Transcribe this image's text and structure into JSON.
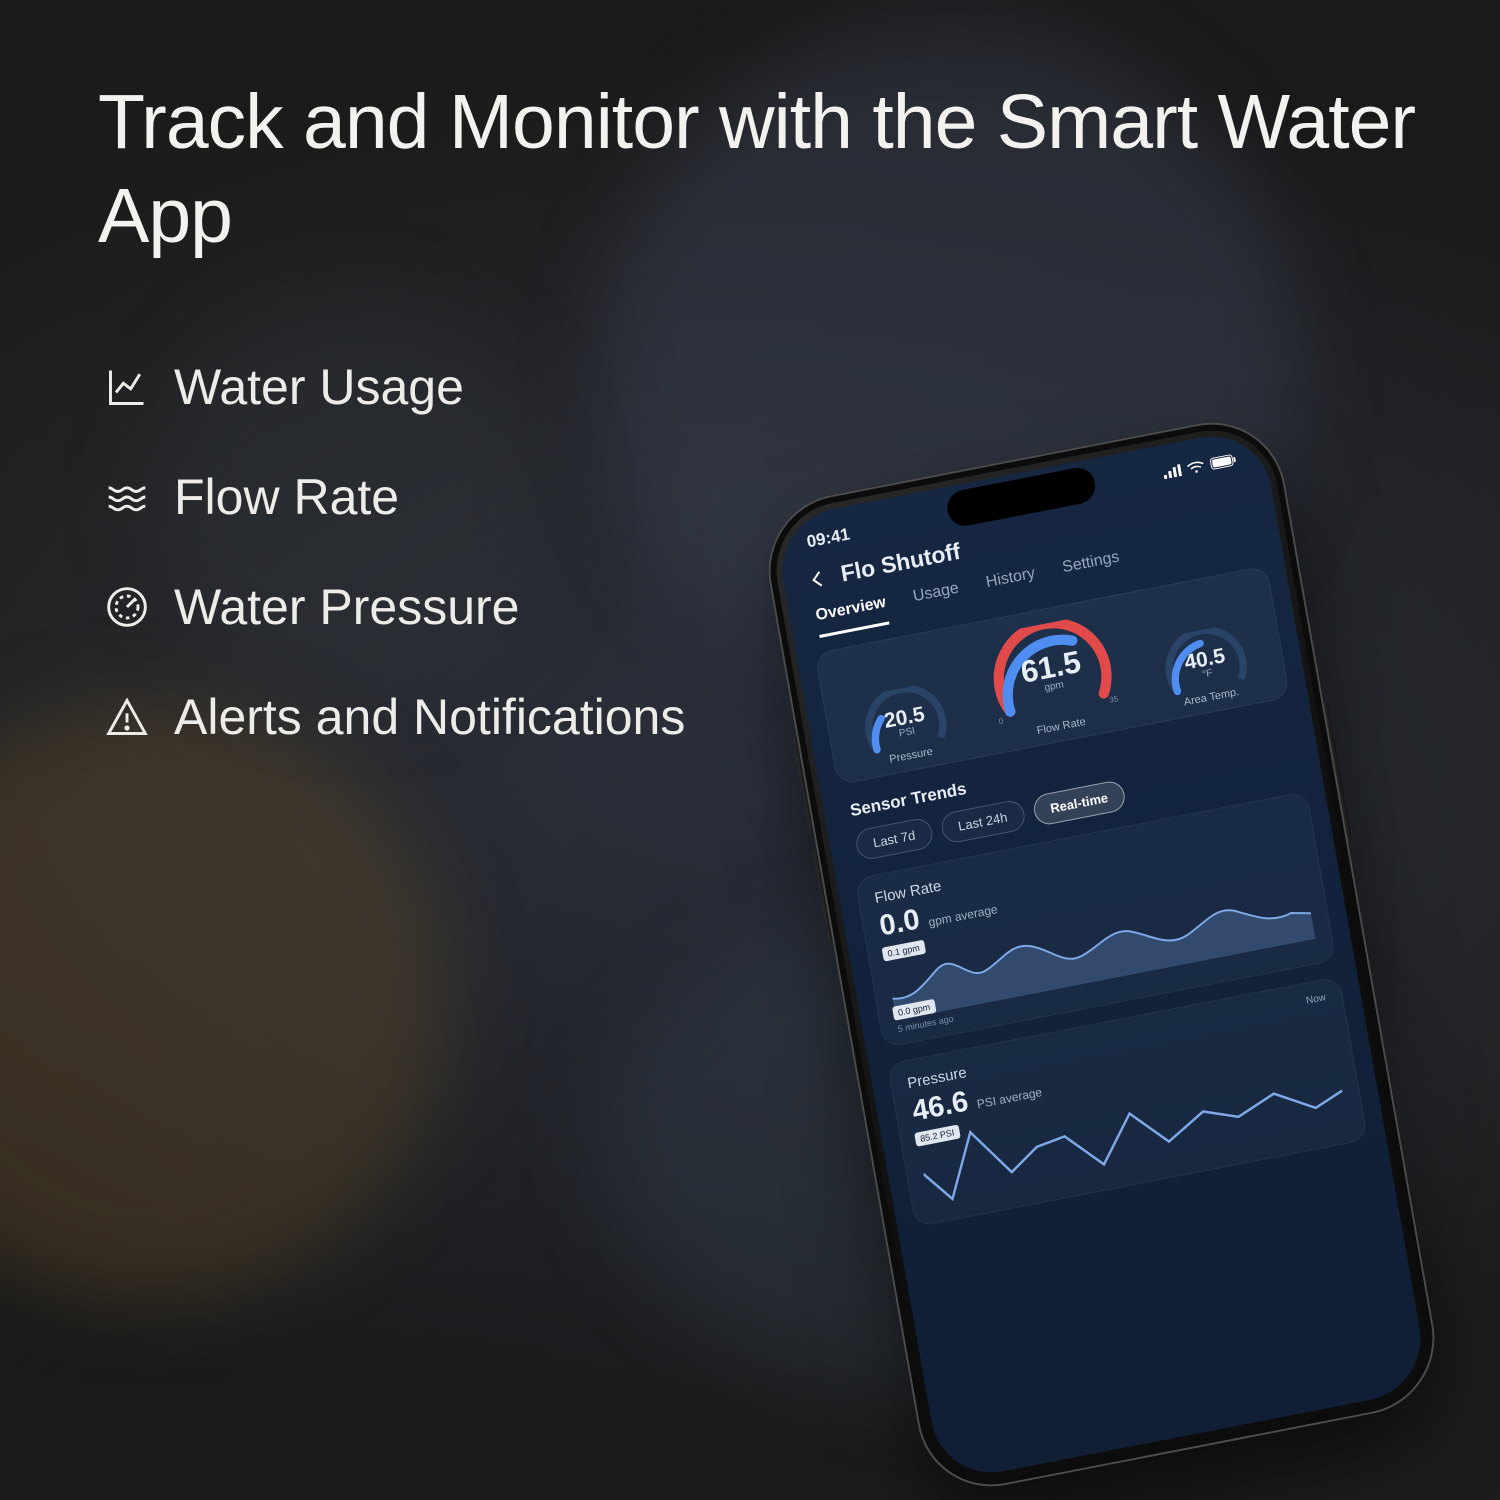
{
  "marketing": {
    "headline": "Track and Monitor with the Smart Water App",
    "bullets": [
      {
        "icon": "chart-line-icon",
        "label": "Water Usage"
      },
      {
        "icon": "waves-icon",
        "label": "Flow Rate"
      },
      {
        "icon": "gauge-icon",
        "label": "Water Pressure"
      },
      {
        "icon": "alert-icon",
        "label": "Alerts and Notifications"
      }
    ]
  },
  "phone": {
    "status_time": "09:41",
    "screen_title": "Flo Shutoff",
    "tabs": [
      "Overview",
      "Usage",
      "History",
      "Settings"
    ],
    "tab_selected": "Overview",
    "gauges": {
      "pressure": {
        "value": "20.5",
        "unit": "PSI",
        "label": "Pressure",
        "scale_min": "0",
        "scale_max": "100"
      },
      "flow": {
        "value": "61.5",
        "unit": "gpm",
        "label": "Flow Rate",
        "scale_min": "0",
        "scale_max": "35"
      },
      "temp": {
        "value": "40.5",
        "unit": "°F",
        "label": "Area Temp.",
        "scale_min": "0",
        "scale_max": "100"
      }
    },
    "sensor_trends": {
      "title": "Sensor Trends",
      "ranges": [
        "Last 7d",
        "Last 24h",
        "Real-time"
      ],
      "range_selected": "Real-time"
    },
    "flow_card": {
      "title": "Flow Rate",
      "value": "0.0",
      "value_sub": "gpm average",
      "tag_high": "0.1 gpm",
      "tag_low": "0.0 gpm",
      "timestamp": "5 minutes ago"
    },
    "pressure_card": {
      "title": "Pressure",
      "value": "46.6",
      "value_sub": "PSI average",
      "now_label": "Now",
      "tag_high": "85.2 PSI"
    }
  },
  "chart_data": [
    {
      "type": "gauge",
      "title": "Pressure",
      "value": 20.5,
      "unit": "PSI",
      "min": 0,
      "max": 100
    },
    {
      "type": "gauge",
      "title": "Flow Rate",
      "value": 61.5,
      "unit": "gpm",
      "min": 0,
      "max": 35
    },
    {
      "type": "gauge",
      "title": "Area Temp.",
      "value": 40.5,
      "unit": "°F",
      "min": 0,
      "max": 100
    },
    {
      "type": "area",
      "title": "Flow Rate",
      "ylabel": "gpm",
      "ylim": [
        0.0,
        0.12
      ],
      "x": [
        0,
        1,
        2,
        3,
        4,
        5,
        6,
        7,
        8,
        9,
        10,
        11,
        12,
        13,
        14,
        15,
        16,
        17,
        18,
        19
      ],
      "values": [
        0.04,
        0.03,
        0.05,
        0.09,
        0.07,
        0.04,
        0.06,
        0.1,
        0.08,
        0.05,
        0.03,
        0.04,
        0.07,
        0.09,
        0.06,
        0.04,
        0.05,
        0.08,
        0.06,
        0.04
      ],
      "annotations": [
        {
          "label": "0.1 gpm",
          "y": 0.1
        },
        {
          "label": "0.0 gpm",
          "y": 0.0
        }
      ],
      "summary": {
        "average_gpm": 0.0,
        "timestamp": "5 minutes ago"
      }
    },
    {
      "type": "line",
      "title": "Pressure",
      "ylabel": "PSI",
      "ylim": [
        0,
        90
      ],
      "x": [
        0,
        1,
        2,
        3,
        4,
        5,
        6,
        7,
        8,
        9,
        10
      ],
      "values": [
        45,
        20,
        80,
        35,
        50,
        55,
        30,
        60,
        40,
        55,
        46
      ],
      "annotations": [
        {
          "label": "85.2 PSI",
          "y": 85.2
        }
      ],
      "summary": {
        "average_psi": 46.6
      }
    }
  ]
}
